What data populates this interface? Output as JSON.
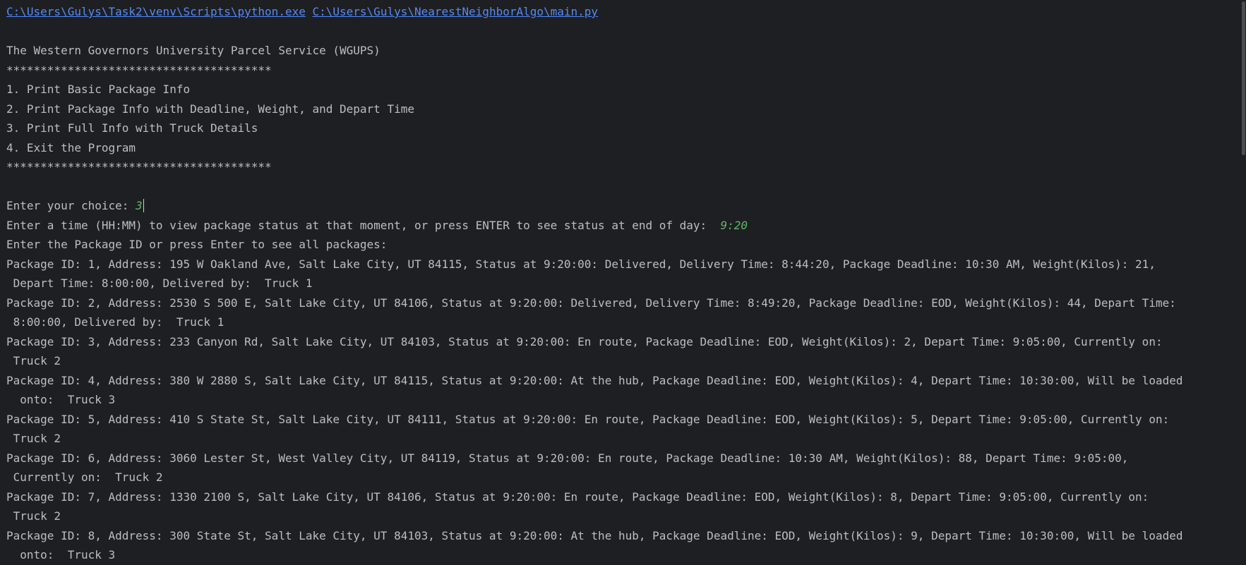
{
  "console": {
    "command": {
      "interpreter_path": "C:\\Users\\Gulys\\Task2\\venv\\Scripts\\python.exe",
      "script_path": "C:\\Users\\Gulys\\NearestNeighborAlgo\\main.py"
    },
    "title": "The Western Governors University Parcel Service (WGUPS)",
    "separator": "***************************************",
    "menu_items": [
      "1. Print Basic Package Info",
      "2. Print Package Info with Deadline, Weight, and Depart Time",
      "3. Print Full Info with Truck Details",
      "4. Exit the Program"
    ],
    "choice_prompt": "Enter your choice: ",
    "choice_value": "3",
    "time_prompt": "Enter a time (HH:MM) to view package status at that moment, or press ENTER to see status at end of day:  ",
    "time_value": "9:20",
    "id_prompt": "Enter the Package ID or press Enter to see all packages:",
    "package_lines": [
      "Package ID: 1, Address: 195 W Oakland Ave, Salt Lake City, UT 84115, Status at 9:20:00: Delivered, Delivery Time: 8:44:20, Package Deadline: 10:30 AM, Weight(Kilos): 21,",
      " Depart Time: 8:00:00, Delivered by:  Truck 1",
      "Package ID: 2, Address: 2530 S 500 E, Salt Lake City, UT 84106, Status at 9:20:00: Delivered, Delivery Time: 8:49:20, Package Deadline: EOD, Weight(Kilos): 44, Depart Time:",
      " 8:00:00, Delivered by:  Truck 1",
      "Package ID: 3, Address: 233 Canyon Rd, Salt Lake City, UT 84103, Status at 9:20:00: En route, Package Deadline: EOD, Weight(Kilos): 2, Depart Time: 9:05:00, Currently on:",
      " Truck 2",
      "Package ID: 4, Address: 380 W 2880 S, Salt Lake City, UT 84115, Status at 9:20:00: At the hub, Package Deadline: EOD, Weight(Kilos): 4, Depart Time: 10:30:00, Will be loaded",
      "  onto:  Truck 3",
      "Package ID: 5, Address: 410 S State St, Salt Lake City, UT 84111, Status at 9:20:00: En route, Package Deadline: EOD, Weight(Kilos): 5, Depart Time: 9:05:00, Currently on:",
      " Truck 2",
      "Package ID: 6, Address: 3060 Lester St, West Valley City, UT 84119, Status at 9:20:00: En route, Package Deadline: 10:30 AM, Weight(Kilos): 88, Depart Time: 9:05:00,",
      " Currently on:  Truck 2",
      "Package ID: 7, Address: 1330 2100 S, Salt Lake City, UT 84106, Status at 9:20:00: En route, Package Deadline: EOD, Weight(Kilos): 8, Depart Time: 9:05:00, Currently on:",
      " Truck 2",
      "Package ID: 8, Address: 300 State St, Salt Lake City, UT 84103, Status at 9:20:00: At the hub, Package Deadline: EOD, Weight(Kilos): 9, Depart Time: 10:30:00, Will be loaded",
      "  onto:  Truck 3"
    ]
  },
  "colors": {
    "background": "#1e1f22",
    "text": "#bcbec4",
    "link": "#548af7",
    "user_input": "#5fb865"
  }
}
